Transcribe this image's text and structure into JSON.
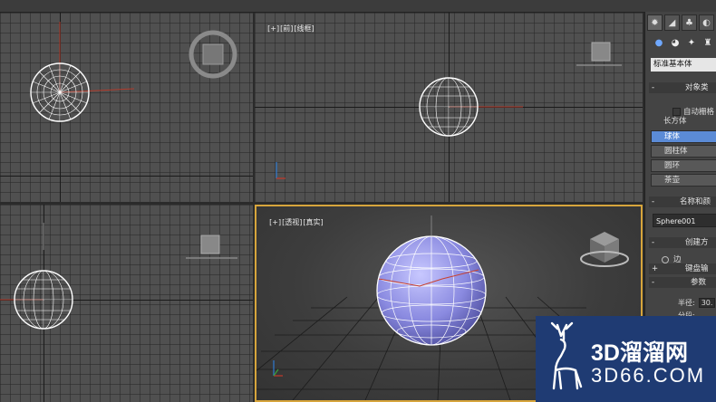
{
  "viewports": {
    "top_left": {
      "label": ""
    },
    "top_right": {
      "label_plus": "[+]",
      "label_view": "[前]",
      "label_mode": "[线框]"
    },
    "bottom_left": {
      "label": ""
    },
    "perspective": {
      "label_plus": "[+]",
      "label_view": "[透视]",
      "label_mode": "[真实]"
    }
  },
  "command_panel": {
    "tabs": [
      {
        "icon": "sun-icon"
      },
      {
        "icon": "curve-icon"
      },
      {
        "icon": "hierarchy-icon"
      },
      {
        "icon": "motion-icon"
      }
    ],
    "category_dropdown": "标准基本体",
    "object_type_rollout": "对象类",
    "autogrid_label": "自动栅格",
    "object_buttons": [
      "长方体",
      "球体",
      "圆柱体",
      "圆环",
      "茶壶"
    ],
    "selected_object": "球体",
    "name_color_rollout": "名称和颜",
    "object_name": "Sphere001",
    "creation_method_rollout": "创建方",
    "creation_radio_label": "边",
    "keyboard_entry_rollout": "键盘输",
    "parameters_rollout": "参数",
    "radius_label": "半径:",
    "radius_value": "30.",
    "segments_label": "分段:"
  },
  "watermark": {
    "line1": "3D溜溜网",
    "line2": "3D66.COM"
  },
  "colors": {
    "selection_blue": "#5b8bd6",
    "active_viewport_border": "#d7a53c",
    "watermark_bg": "#1f3b73"
  }
}
